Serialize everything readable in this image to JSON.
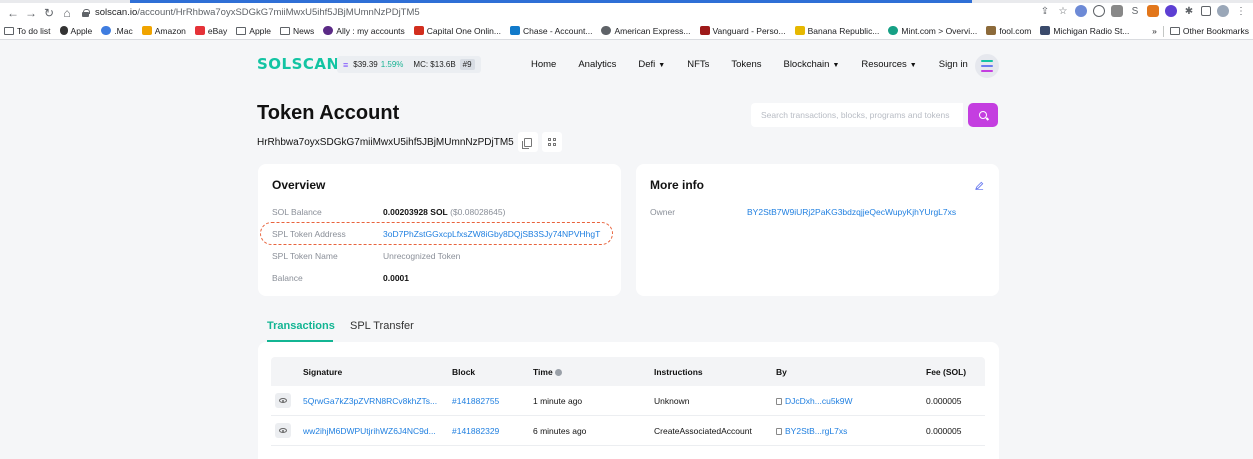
{
  "browser": {
    "url_host": "solscan.io",
    "url_path": "/account/HrRhbwa7oyxSDGkG7miiMwxU5ihf5JBjMUmnNzPDjTM5",
    "bookmarks": [
      {
        "label": "To do list",
        "icon": "folder-icon"
      },
      {
        "label": "Apple",
        "icon": "apple-icon"
      },
      {
        "label": ".Mac",
        "icon": "globe-icon"
      },
      {
        "label": "Amazon",
        "icon": "amazon-icon"
      },
      {
        "label": "eBay",
        "icon": "ebay-icon"
      },
      {
        "label": "Apple",
        "icon": "folder-icon"
      },
      {
        "label": "News",
        "icon": "folder-icon"
      },
      {
        "label": "Ally : my accounts",
        "icon": "ally-icon"
      },
      {
        "label": "Capital One Onlin...",
        "icon": "capital-one-icon"
      },
      {
        "label": "Chase - Account...",
        "icon": "chase-icon"
      },
      {
        "label": "American Express...",
        "icon": "amex-icon"
      },
      {
        "label": "Vanguard - Perso...",
        "icon": "vanguard-icon"
      },
      {
        "label": "Banana Republic...",
        "icon": "banana-republic-icon"
      },
      {
        "label": "Mint.com > Overvi...",
        "icon": "mint-icon"
      },
      {
        "label": "fool.com",
        "icon": "fool-icon"
      },
      {
        "label": "Michigan Radio St...",
        "icon": "radio-icon"
      }
    ],
    "overflow_label": "»",
    "other_bookmarks": "Other Bookmarks"
  },
  "header": {
    "logo": "SOLSCAN",
    "price": "$39.39",
    "price_change": "1.59%",
    "market_cap": "MC: $13.6B",
    "rank": "#9",
    "nav": [
      "Home",
      "Analytics",
      "Defi",
      "NFTs",
      "Tokens",
      "Blockchain",
      "Resources",
      "Sign in"
    ]
  },
  "page": {
    "title": "Token Account",
    "address": "HrRhbwa7oyxSDGkG7miiMwxU5ihf5JBjMUmnNzPDjTM5",
    "search_placeholder": "Search transactions, blocks, programs and tokens"
  },
  "overview": {
    "title": "Overview",
    "sol_balance_label": "SOL Balance",
    "sol_balance_value": "0.00203928 SOL",
    "sol_balance_usd": "($0.08028645)",
    "spl_address_label": "SPL Token Address",
    "spl_address_value": "3oD7PhZstGGxcpLfxsZW8iGby8DQjSB3SJy74NPVHhgT",
    "spl_name_label": "SPL Token Name",
    "spl_name_value": "Unrecognized Token",
    "balance_label": "Balance",
    "balance_value": "0.0001"
  },
  "more_info": {
    "title": "More info",
    "owner_label": "Owner",
    "owner_value": "BY2StB7W9iURj2PaKG3bdzqjjeQecWupyKjhYUrgL7xs"
  },
  "tabs": [
    "Transactions",
    "SPL Transfer"
  ],
  "table": {
    "headers": [
      "Signature",
      "Block",
      "Time",
      "Instructions",
      "By",
      "Fee (SOL)"
    ],
    "rows": [
      {
        "signature": "5QrwGa7kZ3pZVRN8RCv8khZTs...",
        "block": "#141882755",
        "time": "1 minute ago",
        "instructions": "Unknown",
        "by": "DJcDxh...cu5k9W",
        "fee": "0.000005"
      },
      {
        "signature": "ww2ihjM6DWPUtjrihWZ6J4NC9d...",
        "block": "#141882329",
        "time": "6 minutes ago",
        "instructions": "CreateAssociatedAccount",
        "by": "BY2StB...rgL7xs",
        "fee": "0.000005"
      }
    ]
  },
  "colors": {
    "brand_green": "#13c4a3",
    "link_blue": "#1f7fe0",
    "search_purple": "#c43ee0",
    "highlight_orange": "#e8633c"
  }
}
